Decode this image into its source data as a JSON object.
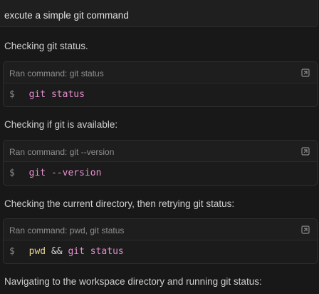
{
  "user_message": "excute a simple git command",
  "steps": [
    {
      "narration": "Checking git status.",
      "card_label": "Ran command: git status",
      "prompt": "$",
      "tokens": [
        "git",
        "status"
      ]
    },
    {
      "narration": "Checking if git is available:",
      "card_label": "Ran command: git --version",
      "prompt": "$",
      "tokens": [
        "git",
        "--version"
      ]
    },
    {
      "narration": "Checking the current directory, then retrying git status:",
      "card_label": "Ran command: pwd, git status",
      "prompt": "$",
      "tokens": [
        "pwd",
        "&&",
        "git",
        "status"
      ]
    }
  ],
  "final_narration": "Navigating to the workspace directory and running git status:",
  "icons": {
    "expand": "expand-icon",
    "prompt": "terminal-prompt"
  },
  "colors": {
    "background": "#181818",
    "command_token": "#e78fd0",
    "operator": "#d4d4d4",
    "shell_builtin": "#e7d58f"
  }
}
